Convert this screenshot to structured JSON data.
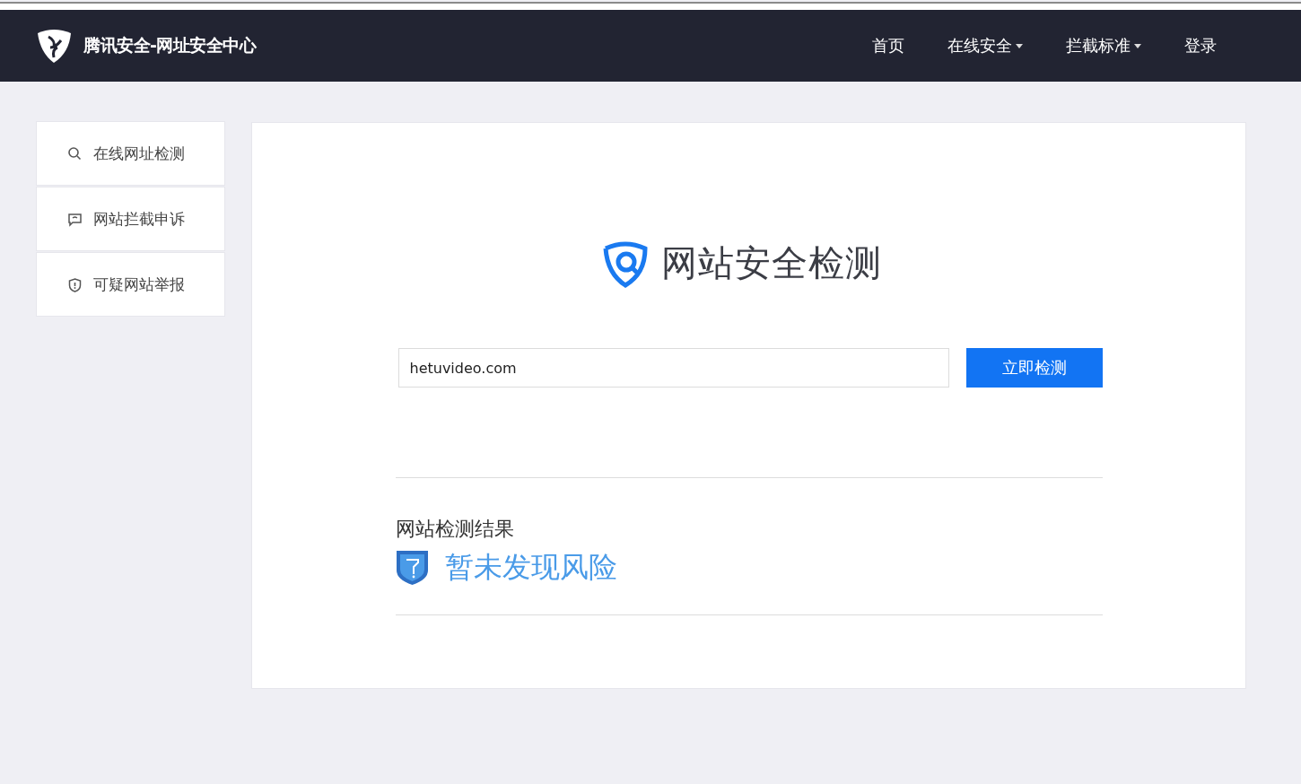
{
  "header": {
    "title": "腾讯安全-网址安全中心",
    "nav": [
      {
        "label": "首页",
        "dropdown": false
      },
      {
        "label": "在线安全",
        "dropdown": true
      },
      {
        "label": "拦截标准",
        "dropdown": true
      },
      {
        "label": "登录",
        "dropdown": false
      }
    ]
  },
  "sidebar": {
    "items": [
      {
        "label": "在线网址检测",
        "kind": "search"
      },
      {
        "label": "网站拦截申诉",
        "kind": "comment"
      },
      {
        "label": "可疑网站举报",
        "kind": "shield"
      }
    ]
  },
  "main": {
    "heading": "网站安全检测",
    "url_field": {
      "value": "hetuvideo.com"
    },
    "check_button": "立即检测",
    "result_label": "网站检测结果",
    "result_text": "暂未发现风险"
  }
}
